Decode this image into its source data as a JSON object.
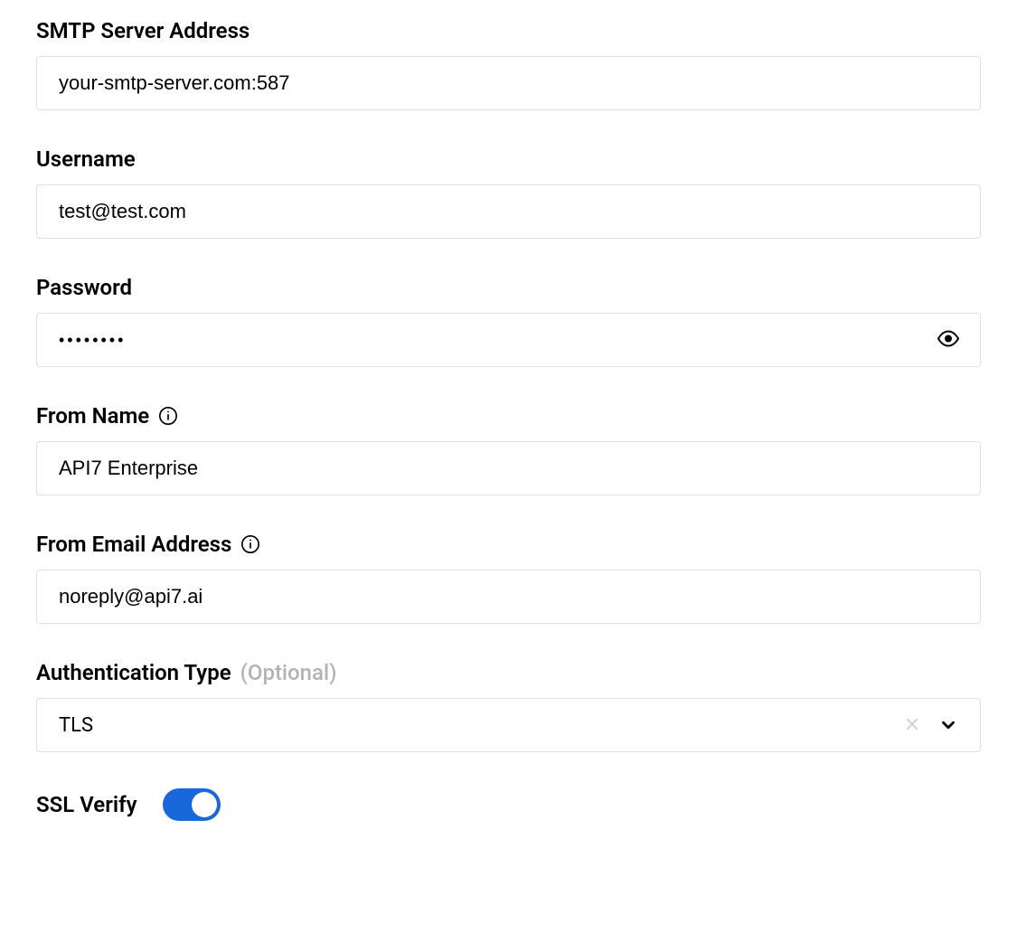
{
  "fields": {
    "smtp_address": {
      "label": "SMTP Server Address",
      "value": "your-smtp-server.com:587"
    },
    "username": {
      "label": "Username",
      "value": "test@test.com"
    },
    "password": {
      "label": "Password",
      "value": "••••••••"
    },
    "from_name": {
      "label": "From Name",
      "value": "API7 Enterprise"
    },
    "from_email": {
      "label": "From Email Address",
      "value": "noreply@api7.ai"
    },
    "auth_type": {
      "label": "Authentication Type",
      "optional_text": "(Optional)",
      "value": "TLS"
    },
    "ssl_verify": {
      "label": "SSL Verify",
      "enabled": true
    }
  }
}
